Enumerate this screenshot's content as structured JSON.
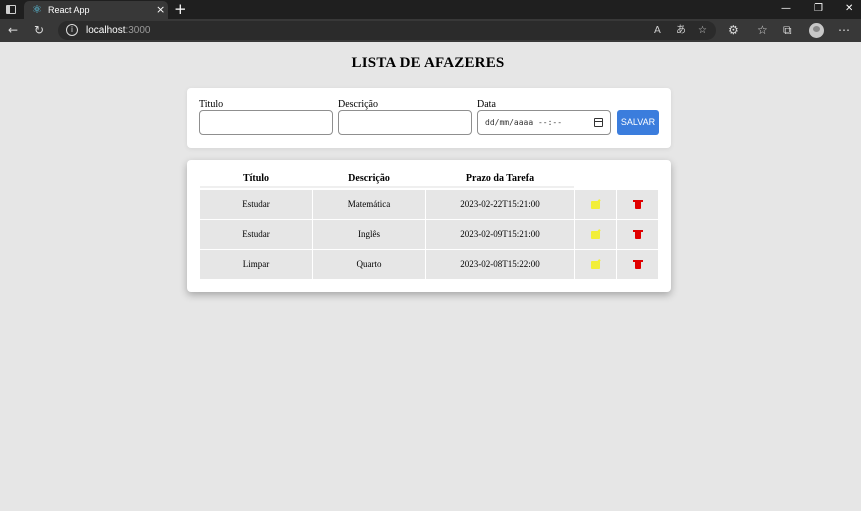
{
  "browser": {
    "tab": {
      "title": "React App"
    },
    "url": {
      "host": "localhost",
      "port": ":3000"
    }
  },
  "page": {
    "title": "LISTA DE AFAZERES"
  },
  "form": {
    "titulo_label": "Titulo",
    "titulo_value": "",
    "descricao_label": "Descrição",
    "descricao_value": "",
    "data_label": "Data",
    "data_placeholder": "dd/mm/aaaa --:--",
    "save_label": "SALVAR"
  },
  "table": {
    "headers": [
      "Título",
      "Descrição",
      "Prazo da Tarefa"
    ],
    "rows": [
      {
        "titulo": "Estudar",
        "descricao": "Matemática",
        "prazo": "2023-02-22T15:21:00"
      },
      {
        "titulo": "Estudar",
        "descricao": "Inglês",
        "prazo": "2023-02-09T15:21:00"
      },
      {
        "titulo": "Limpar",
        "descricao": "Quarto",
        "prazo": "2023-02-08T15:22:00"
      }
    ]
  },
  "colors": {
    "accent": "#3b7ddd",
    "edit": "#f2ee3a",
    "delete": "#e00000",
    "background": "#e6e6e6"
  },
  "icons": {
    "edit": "edit-icon",
    "delete": "trash-icon"
  }
}
